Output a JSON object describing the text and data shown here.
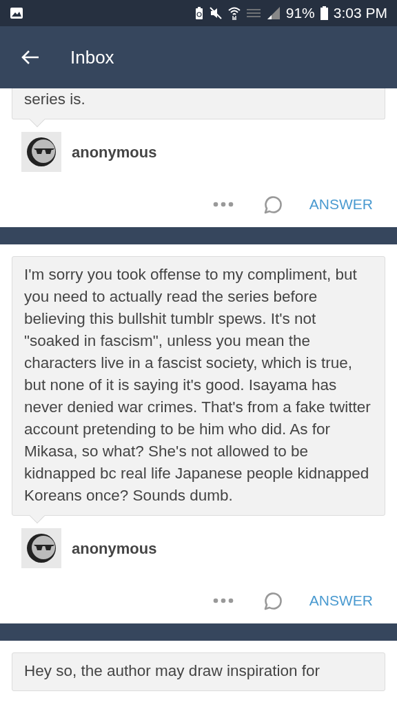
{
  "status_bar": {
    "battery": "91%",
    "time": "3:03 PM"
  },
  "app_bar": {
    "title": "Inbox"
  },
  "messages": [
    {
      "text": "series is.",
      "sender": "anonymous",
      "answer": "ANSWER"
    },
    {
      "text": "I'm sorry you took offense to my compliment, but you need to actually read the series before believing this bullshit tumblr spews. It's not \"soaked in fascism\", unless you mean the characters live in a fascist society, which is true, but none of it is saying it's good. Isayama has never denied war crimes. That's from a fake twitter account pretending to be him who did. As for Mikasa, so what? She's not allowed to be kidnapped bc real life Japanese people kidnapped Koreans once? Sounds dumb.",
      "sender": "anonymous",
      "answer": "ANSWER"
    },
    {
      "text": "Hey so, the author may draw inspiration for"
    }
  ]
}
